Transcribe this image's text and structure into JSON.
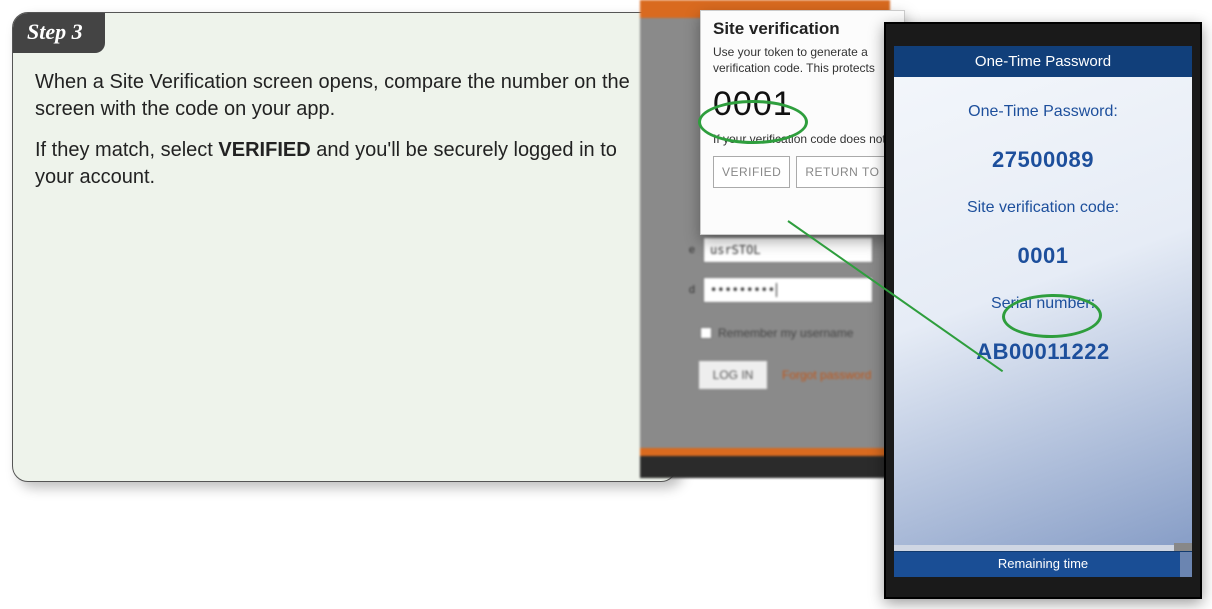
{
  "card": {
    "step_badge": "Step 3",
    "line1_a": "When a Site Verification screen opens, compare the number on the screen with the code on your app.",
    "line2_a": "If they match, select ",
    "line2_b": "VERIFIED",
    "line2_c": " and you'll be securely logged in to your account."
  },
  "login": {
    "username_value": "usrSTOL",
    "password_masked": "•••••••••",
    "remember_label": "Remember my username",
    "login_btn": "LOG IN",
    "forgot": "Forgot password"
  },
  "site_verif": {
    "title": "Site verification",
    "desc": "Use your token to generate a verification code. This protects your account by ensuring",
    "code": "0001",
    "note": "If your verification code does not match",
    "btn_verified": "VERIFIED",
    "btn_return": "RETURN TO"
  },
  "phone": {
    "header": "One-Time Password",
    "otp_label": "One-Time Password:",
    "otp_value": "27500089",
    "svc_label": "Site verification code:",
    "svc_value": "0001",
    "serial_label": "Serial number:",
    "serial_value": "AB00011222",
    "remaining": "Remaining time"
  },
  "colors": {
    "accent_green": "#2e9e3d",
    "brand_blue": "#1d4f9c",
    "orange": "#d96a1f"
  }
}
